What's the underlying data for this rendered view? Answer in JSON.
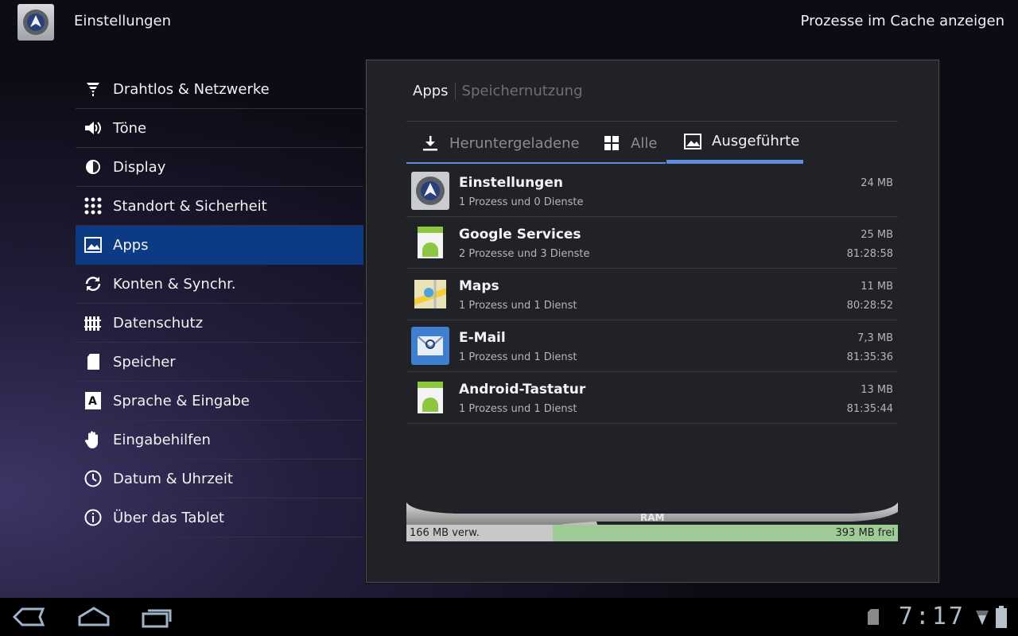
{
  "header": {
    "title": "Einstellungen",
    "overflow_action": "Prozesse im Cache anzeigen"
  },
  "sidebar": {
    "items": [
      {
        "label": "Drahtlos & Netzwerke",
        "icon": "wifi-icon"
      },
      {
        "label": "Töne",
        "icon": "speaker-icon"
      },
      {
        "label": "Display",
        "icon": "brightness-icon"
      },
      {
        "label": "Standort & Sicherheit",
        "icon": "grid-lock-icon"
      },
      {
        "label": "Apps",
        "icon": "apps-icon",
        "selected": true
      },
      {
        "label": "Konten & Synchr.",
        "icon": "sync-icon"
      },
      {
        "label": "Datenschutz",
        "icon": "fence-icon"
      },
      {
        "label": "Speicher",
        "icon": "sd-card-icon"
      },
      {
        "label": "Sprache & Eingabe",
        "icon": "keyboard-letter-icon"
      },
      {
        "label": "Eingabehilfen",
        "icon": "hand-icon"
      },
      {
        "label": "Datum & Uhrzeit",
        "icon": "clock-icon"
      },
      {
        "label": "Über das Tablet",
        "icon": "info-icon"
      }
    ]
  },
  "panel": {
    "tabs": {
      "apps": "Apps",
      "storage": "Speichernutzung"
    },
    "subtabs": [
      {
        "label": "Heruntergeladene",
        "icon": "download-icon"
      },
      {
        "label": "Alle",
        "icon": "grid-icon"
      },
      {
        "label": "Ausgeführte",
        "icon": "running-apps-icon",
        "active": true
      }
    ],
    "apps": [
      {
        "name": "Einstellungen",
        "sub": "1 Prozess und 0 Dienste",
        "size": "24 MB",
        "time": "",
        "icon": "settings-app-icon"
      },
      {
        "name": "Google Services",
        "sub": "2 Prozesse und 3 Dienste",
        "size": "25 MB",
        "time": "81:28:58",
        "icon": "android-app-icon"
      },
      {
        "name": "Maps",
        "sub": "1 Prozess und 1 Dienst",
        "size": "11 MB",
        "time": "80:28:52",
        "icon": "maps-app-icon"
      },
      {
        "name": "E-Mail",
        "sub": "1 Prozess und 1 Dienst",
        "size": "7,3 MB",
        "time": "81:35:36",
        "icon": "email-app-icon"
      },
      {
        "name": "Android-Tastatur",
        "sub": "1 Prozess und 1 Dienst",
        "size": "13 MB",
        "time": "81:35:44",
        "icon": "android-app-icon"
      }
    ],
    "ram": {
      "label": "RAM",
      "used_label": "166 MB verw.",
      "free_label": "393 MB frei",
      "used_mb": 166,
      "free_mb": 393
    }
  },
  "system_bar": {
    "clock": "7:17"
  },
  "colors": {
    "accent": "#5d8ce0",
    "selected_bg": "#0c3a83",
    "ram_used": "#c8c8c8",
    "ram_free": "#9ecb96"
  }
}
